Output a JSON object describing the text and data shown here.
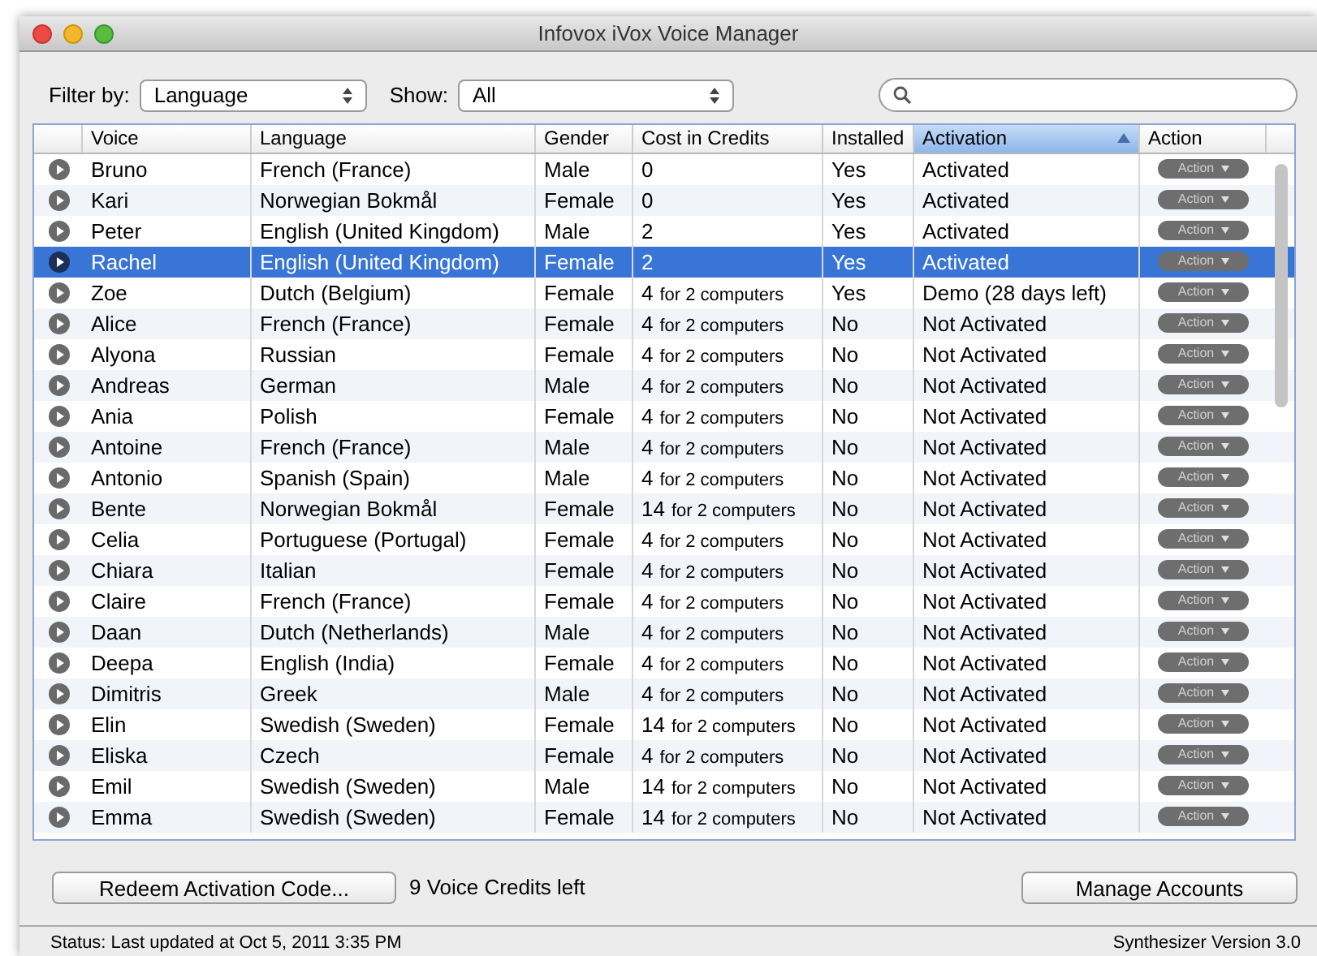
{
  "window": {
    "title": "Infovox iVox Voice Manager"
  },
  "filter": {
    "label": "Filter by:",
    "value": "Language"
  },
  "show": {
    "label": "Show:",
    "value": "All"
  },
  "search": {
    "kind": "search"
  },
  "table": {
    "columns": [
      {
        "label": "Voice",
        "sorted": false
      },
      {
        "label": "Language",
        "sorted": false
      },
      {
        "label": "Gender",
        "sorted": false
      },
      {
        "label": "Cost in Credits",
        "sorted": false
      },
      {
        "label": "Installed",
        "sorted": false
      },
      {
        "label": "Activation",
        "sorted": true
      },
      {
        "label": "Action",
        "sorted": false
      }
    ],
    "rows": [
      {
        "voice": "Bruno",
        "language": "French (France)",
        "gender": "Male",
        "cost": "0",
        "installed": "Yes",
        "activation": "Activated",
        "action": "Action",
        "selected": false
      },
      {
        "voice": "Kari",
        "language": "Norwegian Bokmål",
        "gender": "Female",
        "cost": "0",
        "installed": "Yes",
        "activation": "Activated",
        "action": "Action",
        "selected": false
      },
      {
        "voice": "Peter",
        "language": "English (United Kingdom)",
        "gender": "Male",
        "cost": "2",
        "installed": "Yes",
        "activation": "Activated",
        "action": "Action",
        "selected": false
      },
      {
        "voice": "Rachel",
        "language": "English (United Kingdom)",
        "gender": "Female",
        "cost": "2",
        "installed": "Yes",
        "activation": "Activated",
        "action": "Action",
        "selected": true
      },
      {
        "voice": "Zoe",
        "language": "Dutch (Belgium)",
        "gender": "Female",
        "cost": "4",
        "cost_note": "for 2 computers",
        "installed": "Yes",
        "activation": "Demo (28 days left)",
        "action": "Action",
        "selected": false
      },
      {
        "voice": "Alice",
        "language": "French (France)",
        "gender": "Female",
        "cost": "4",
        "cost_note": "for 2 computers",
        "installed": "No",
        "activation": "Not Activated",
        "action": "Action",
        "selected": false
      },
      {
        "voice": "Alyona",
        "language": "Russian",
        "gender": "Female",
        "cost": "4",
        "cost_note": "for 2 computers",
        "installed": "No",
        "activation": "Not Activated",
        "action": "Action",
        "selected": false
      },
      {
        "voice": "Andreas",
        "language": "German",
        "gender": "Male",
        "cost": "4",
        "cost_note": "for 2 computers",
        "installed": "No",
        "activation": "Not Activated",
        "action": "Action",
        "selected": false
      },
      {
        "voice": "Ania",
        "language": "Polish",
        "gender": "Female",
        "cost": "4",
        "cost_note": "for 2 computers",
        "installed": "No",
        "activation": "Not Activated",
        "action": "Action",
        "selected": false
      },
      {
        "voice": "Antoine",
        "language": "French (France)",
        "gender": "Male",
        "cost": "4",
        "cost_note": "for 2 computers",
        "installed": "No",
        "activation": "Not Activated",
        "action": "Action",
        "selected": false
      },
      {
        "voice": "Antonio",
        "language": "Spanish (Spain)",
        "gender": "Male",
        "cost": "4",
        "cost_note": "for 2 computers",
        "installed": "No",
        "activation": "Not Activated",
        "action": "Action",
        "selected": false
      },
      {
        "voice": "Bente",
        "language": "Norwegian Bokmål",
        "gender": "Female",
        "cost": "14",
        "cost_note": "for 2 computers",
        "installed": "No",
        "activation": "Not Activated",
        "action": "Action",
        "selected": false
      },
      {
        "voice": "Celia",
        "language": "Portuguese (Portugal)",
        "gender": "Female",
        "cost": "4",
        "cost_note": "for 2 computers",
        "installed": "No",
        "activation": "Not Activated",
        "action": "Action",
        "selected": false
      },
      {
        "voice": "Chiara",
        "language": "Italian",
        "gender": "Female",
        "cost": "4",
        "cost_note": "for 2 computers",
        "installed": "No",
        "activation": "Not Activated",
        "action": "Action",
        "selected": false
      },
      {
        "voice": "Claire",
        "language": "French (France)",
        "gender": "Female",
        "cost": "4",
        "cost_note": "for 2 computers",
        "installed": "No",
        "activation": "Not Activated",
        "action": "Action",
        "selected": false
      },
      {
        "voice": "Daan",
        "language": "Dutch (Netherlands)",
        "gender": "Male",
        "cost": "4",
        "cost_note": "for 2 computers",
        "installed": "No",
        "activation": "Not Activated",
        "action": "Action",
        "selected": false
      },
      {
        "voice": "Deepa",
        "language": "English (India)",
        "gender": "Female",
        "cost": "4",
        "cost_note": "for 2 computers",
        "installed": "No",
        "activation": "Not Activated",
        "action": "Action",
        "selected": false
      },
      {
        "voice": "Dimitris",
        "language": "Greek",
        "gender": "Male",
        "cost": "4",
        "cost_note": "for 2 computers",
        "installed": "No",
        "activation": "Not Activated",
        "action": "Action",
        "selected": false
      },
      {
        "voice": "Elin",
        "language": "Swedish (Sweden)",
        "gender": "Female",
        "cost": "14",
        "cost_note": "for 2 computers",
        "installed": "No",
        "activation": "Not Activated",
        "action": "Action",
        "selected": false
      },
      {
        "voice": "Eliska",
        "language": "Czech",
        "gender": "Female",
        "cost": "4",
        "cost_note": "for 2 computers",
        "installed": "No",
        "activation": "Not Activated",
        "action": "Action",
        "selected": false
      },
      {
        "voice": "Emil",
        "language": "Swedish (Sweden)",
        "gender": "Male",
        "cost": "14",
        "cost_note": "for 2 computers",
        "installed": "No",
        "activation": "Not Activated",
        "action": "Action",
        "selected": false
      },
      {
        "voice": "Emma",
        "language": "Swedish (Sweden)",
        "gender": "Female",
        "cost": "14",
        "cost_note": "for 2 computers",
        "installed": "No",
        "activation": "Not Activated",
        "action": "Action",
        "selected": false
      }
    ]
  },
  "redeem_button": "Redeem Activation Code...",
  "credits_left": "9 Voice Credits left",
  "manage_button": "Manage Accounts",
  "status_bar": {
    "status": "Status: Last updated at Oct 5, 2011 3:35 PM",
    "version": "Synthesizer Version 3.0"
  }
}
